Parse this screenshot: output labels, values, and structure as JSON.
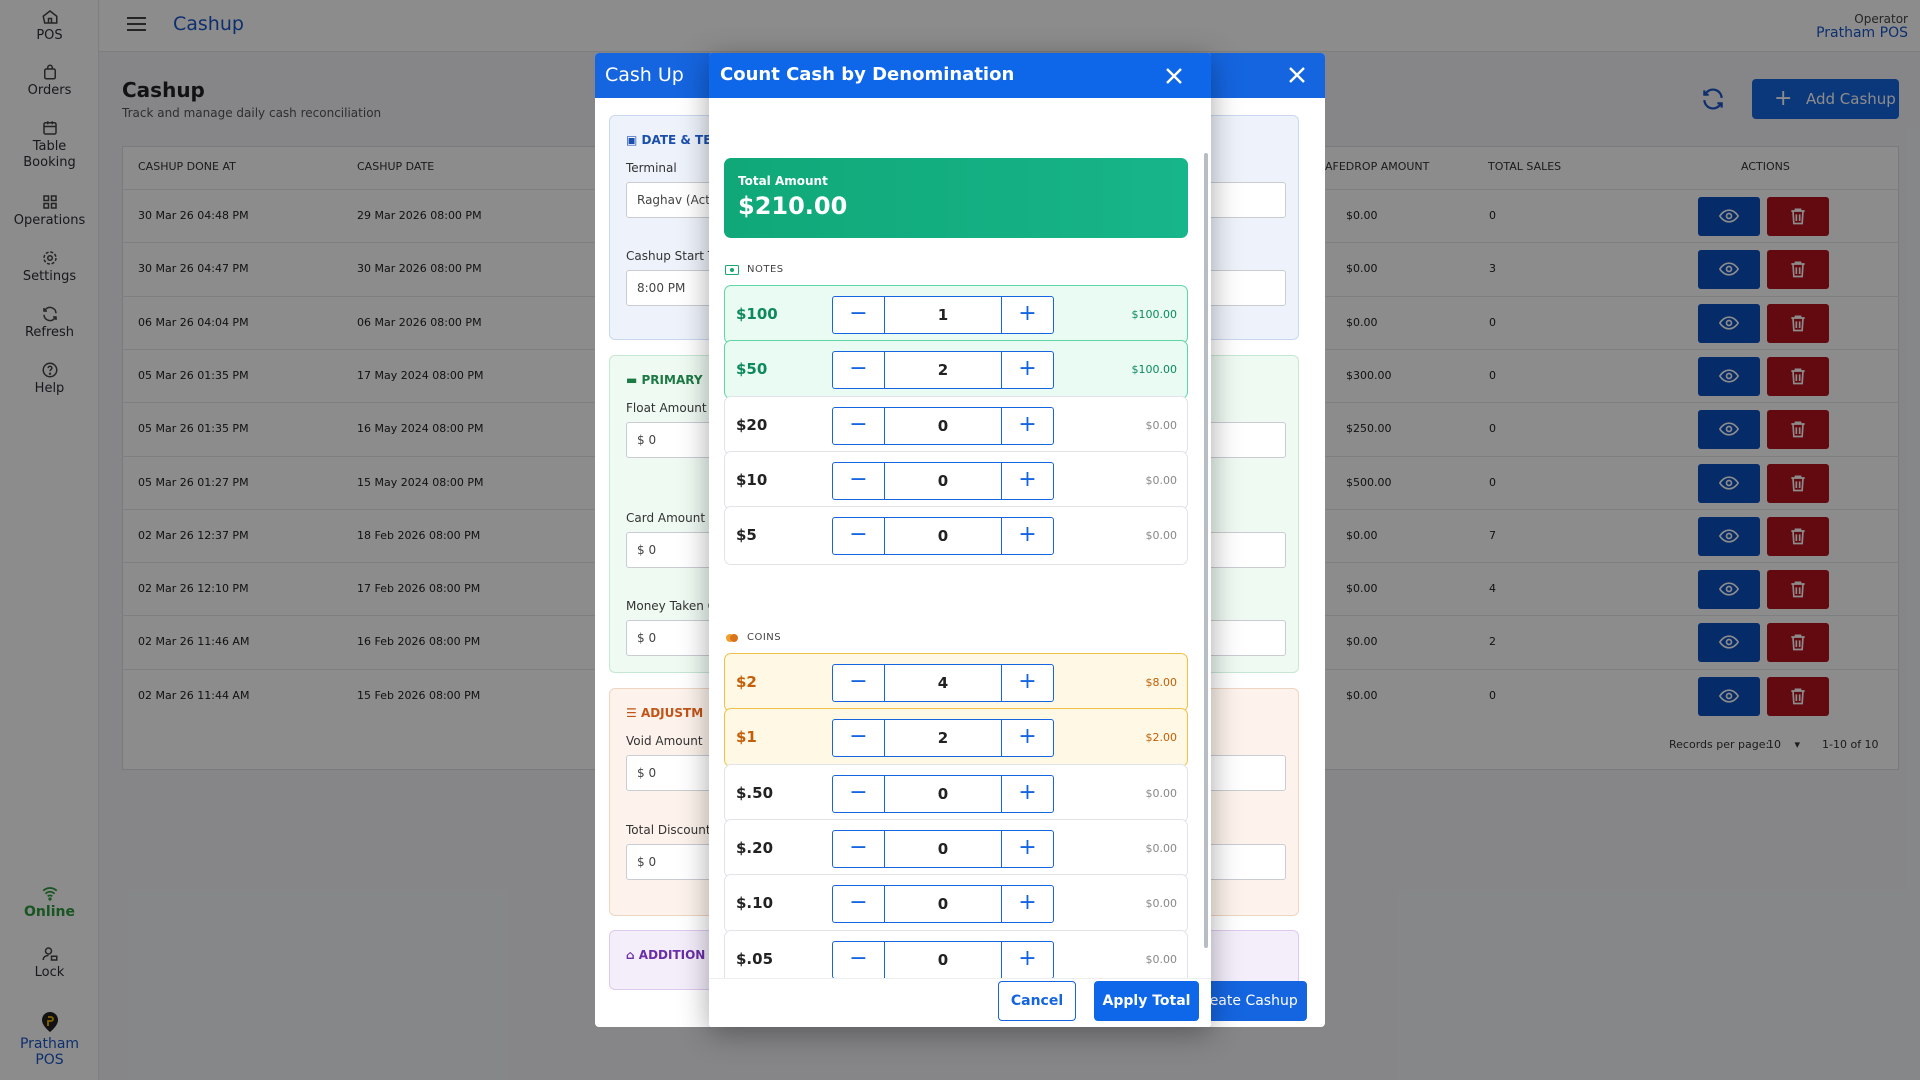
{
  "sidebar": {
    "items": [
      {
        "label": "POS",
        "icon": "home-icon"
      },
      {
        "label": "Orders",
        "icon": "bag-icon"
      },
      {
        "label": "Table Booking",
        "icon": "calendar-icon"
      },
      {
        "label": "Operations",
        "icon": "grid-icon"
      },
      {
        "label": "Settings",
        "icon": "gear-icon"
      },
      {
        "label": "Refresh",
        "icon": "refresh-icon"
      },
      {
        "label": "Help",
        "icon": "help-icon"
      }
    ],
    "status": "Online",
    "lock": "Lock",
    "brand": "Pratham POS"
  },
  "header": {
    "title": "Cashup",
    "operator_label": "Operator",
    "operator_name": "Pratham POS"
  },
  "page": {
    "title": "Cashup",
    "subtitle": "Track and manage daily cash reconciliation",
    "add_button": "Add Cashup"
  },
  "table": {
    "columns": [
      "CASHUP DONE AT",
      "CASHUP DATE",
      "AFEDROP AMOUNT",
      "TOTAL SALES",
      "ACTIONS"
    ],
    "rows": [
      {
        "done_at": "30 Mar 26 04:48 PM",
        "date": "29 Mar 2026 08:00 PM",
        "safedrop": "$0.00",
        "sales": "0"
      },
      {
        "done_at": "30 Mar 26 04:47 PM",
        "date": "30 Mar 2026 08:00 PM",
        "safedrop": "$0.00",
        "sales": "3"
      },
      {
        "done_at": "06 Mar 26 04:04 PM",
        "date": "06 Mar 2026 08:00 PM",
        "safedrop": "$0.00",
        "sales": "0"
      },
      {
        "done_at": "05 Mar 26 01:35 PM",
        "date": "17 May 2024 08:00 PM",
        "safedrop": "$300.00",
        "sales": "0"
      },
      {
        "done_at": "05 Mar 26 01:35 PM",
        "date": "16 May 2024 08:00 PM",
        "safedrop": "$250.00",
        "sales": "0"
      },
      {
        "done_at": "05 Mar 26 01:27 PM",
        "date": "15 May 2024 08:00 PM",
        "safedrop": "$500.00",
        "sales": "0"
      },
      {
        "done_at": "02 Mar 26 12:37 PM",
        "date": "18 Feb 2026 08:00 PM",
        "safedrop": "$0.00",
        "sales": "7"
      },
      {
        "done_at": "02 Mar 26 12:10 PM",
        "date": "17 Feb 2026 08:00 PM",
        "safedrop": "$0.00",
        "sales": "4"
      },
      {
        "done_at": "02 Mar 26 11:46 AM",
        "date": "16 Feb 2026 08:00 PM",
        "safedrop": "$0.00",
        "sales": "2"
      },
      {
        "done_at": "02 Mar 26 11:44 AM",
        "date": "15 Feb 2026 08:00 PM",
        "safedrop": "$0.00",
        "sales": "0"
      }
    ],
    "records_per_page_label": "Records per page:",
    "records_per_page": "10",
    "range": "1-10 of 10"
  },
  "cashup_modal": {
    "title": "Cash Up",
    "date_section": "DATE & TE",
    "terminal_label": "Terminal",
    "terminal_value": "Raghav (Activ",
    "start_label": "Cashup Start Ti",
    "start_value": "8:00 PM",
    "primary_section": "PRIMARY",
    "float_label": "Float Amount",
    "float_value": "$ 0",
    "card_label": "Card Amount",
    "card_value": "$ 0",
    "money_label": "Money Taken O",
    "money_value": "$ 0",
    "adjust_section": "ADJUSTM",
    "void_label": "Void Amount",
    "void_value": "$ 0",
    "discount_label": "Total Discount",
    "discount_value": "$ 0",
    "additional_section": "ADDITION",
    "create_button": "reate Cashup",
    "required_mark": "*"
  },
  "denom_modal": {
    "title": "Count Cash by Denomination",
    "total_label": "Total Amount",
    "total_value": "$210.00",
    "notes_label": "NOTES",
    "coins_label": "COINS",
    "notes": [
      {
        "label": "$100",
        "count": "1",
        "subtotal": "$100.00",
        "active": true
      },
      {
        "label": "$50",
        "count": "2",
        "subtotal": "$100.00",
        "active": true
      },
      {
        "label": "$20",
        "count": "0",
        "subtotal": "$0.00",
        "active": false
      },
      {
        "label": "$10",
        "count": "0",
        "subtotal": "$0.00",
        "active": false
      },
      {
        "label": "$5",
        "count": "0",
        "subtotal": "$0.00",
        "active": false
      }
    ],
    "coins": [
      {
        "label": "$2",
        "count": "4",
        "subtotal": "$8.00",
        "active": true
      },
      {
        "label": "$1",
        "count": "2",
        "subtotal": "$2.00",
        "active": true
      },
      {
        "label": "$.50",
        "count": "0",
        "subtotal": "$0.00",
        "active": false
      },
      {
        "label": "$.20",
        "count": "0",
        "subtotal": "$0.00",
        "active": false
      },
      {
        "label": "$.10",
        "count": "0",
        "subtotal": "$0.00",
        "active": false
      },
      {
        "label": "$.05",
        "count": "0",
        "subtotal": "$0.00",
        "active": false
      }
    ],
    "minus_glyph": "−",
    "plus_glyph": "+",
    "cancel_button": "Cancel",
    "apply_button": "Apply Total"
  },
  "colors": {
    "primary": "#1565e0",
    "danger": "#b4111e",
    "success": "#10a878",
    "coin_accent": "#c35f08"
  }
}
